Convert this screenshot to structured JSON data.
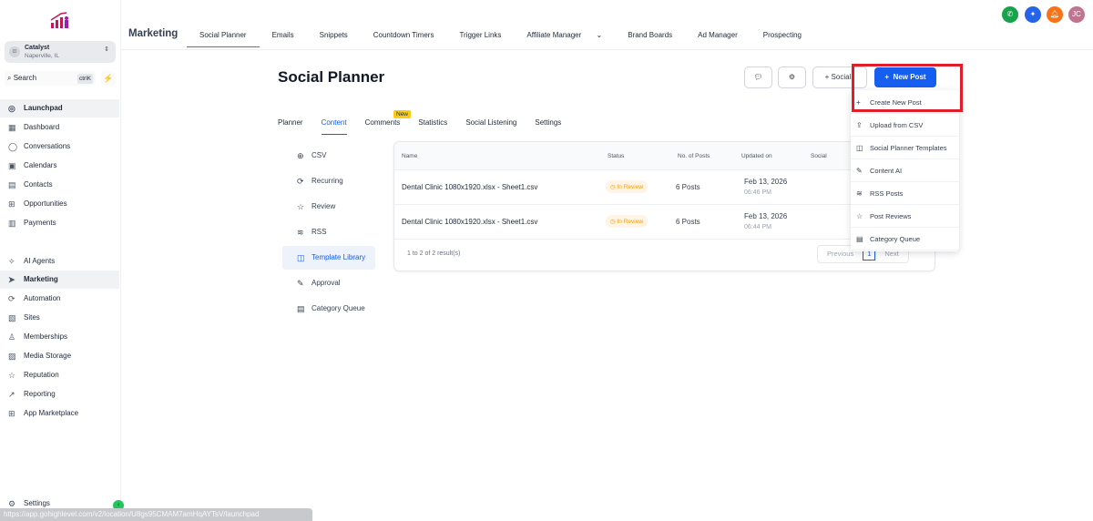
{
  "sidebar": {
    "location_name": "Catalyst",
    "location_city": "Naperville, IL",
    "search_label": "Search",
    "search_shortcut": "ctrlK",
    "items": [
      {
        "label": "Launchpad",
        "icon": "launchpad-icon"
      },
      {
        "label": "Dashboard",
        "icon": "dashboard-icon"
      },
      {
        "label": "Conversations",
        "icon": "chat-icon"
      },
      {
        "label": "Calendars",
        "icon": "calendar-icon"
      },
      {
        "label": "Contacts",
        "icon": "contacts-icon"
      },
      {
        "label": "Opportunities",
        "icon": "opportunities-icon"
      },
      {
        "label": "Payments",
        "icon": "payments-icon"
      },
      {
        "label": "AI Agents",
        "icon": "ai-icon"
      },
      {
        "label": "Marketing",
        "icon": "send-icon"
      },
      {
        "label": "Automation",
        "icon": "automation-icon"
      },
      {
        "label": "Sites",
        "icon": "sites-icon"
      },
      {
        "label": "Memberships",
        "icon": "memberships-icon"
      },
      {
        "label": "Media Storage",
        "icon": "media-icon"
      },
      {
        "label": "Reputation",
        "icon": "star-icon"
      },
      {
        "label": "Reporting",
        "icon": "reporting-icon"
      },
      {
        "label": "App Marketplace",
        "icon": "apps-icon"
      }
    ],
    "settings_label": "Settings"
  },
  "header": {
    "title": "Marketing",
    "tabs": [
      "Social Planner",
      "Emails",
      "Snippets",
      "Countdown Timers",
      "Trigger Links",
      "Affiliate Manager",
      "Brand Boards",
      "Ad Manager",
      "Prospecting"
    ],
    "avatar_initials": "JC"
  },
  "page": {
    "title": "Social Planner",
    "socials_label": "Socials",
    "new_post_label": "New Post",
    "subtabs": [
      "Planner",
      "Content",
      "Comments",
      "Statistics",
      "Social Listening",
      "Settings"
    ],
    "new_badge": "New",
    "left_menu": [
      "CSV",
      "Recurring",
      "Review",
      "RSS",
      "Template Library",
      "Approval",
      "Category Queue"
    ]
  },
  "table": {
    "headers": [
      "Name",
      "Status",
      "No. of Posts",
      "Updated on",
      "Social"
    ],
    "rows": [
      {
        "name": "Dental Clinic 1080x1920.xlsx - Sheet1.csv",
        "status": "In Review",
        "posts": "6 Posts",
        "date": "Feb 13, 2026",
        "time": "06:46 PM"
      },
      {
        "name": "Dental Clinic 1080x1920.xlsx - Sheet1.csv",
        "status": "In Review",
        "posts": "6 Posts",
        "date": "Feb 13, 2026",
        "time": "06:44 PM"
      }
    ],
    "footer": "1 to 2 of 2 result(s)",
    "prev": "Previous",
    "page": "1",
    "next": "Next"
  },
  "dropdown": [
    "Create New Post",
    "Upload from CSV",
    "Social Planner Templates",
    "Content AI",
    "RSS Posts",
    "Post Reviews",
    "Category Queue"
  ],
  "status_url": "https://app.gohighlevel.com/v2/location/U8gs95CMAM7amHqAYTsV/launchpad",
  "colors": {
    "accent": "#155eef",
    "highlight": "#e11d2a"
  }
}
